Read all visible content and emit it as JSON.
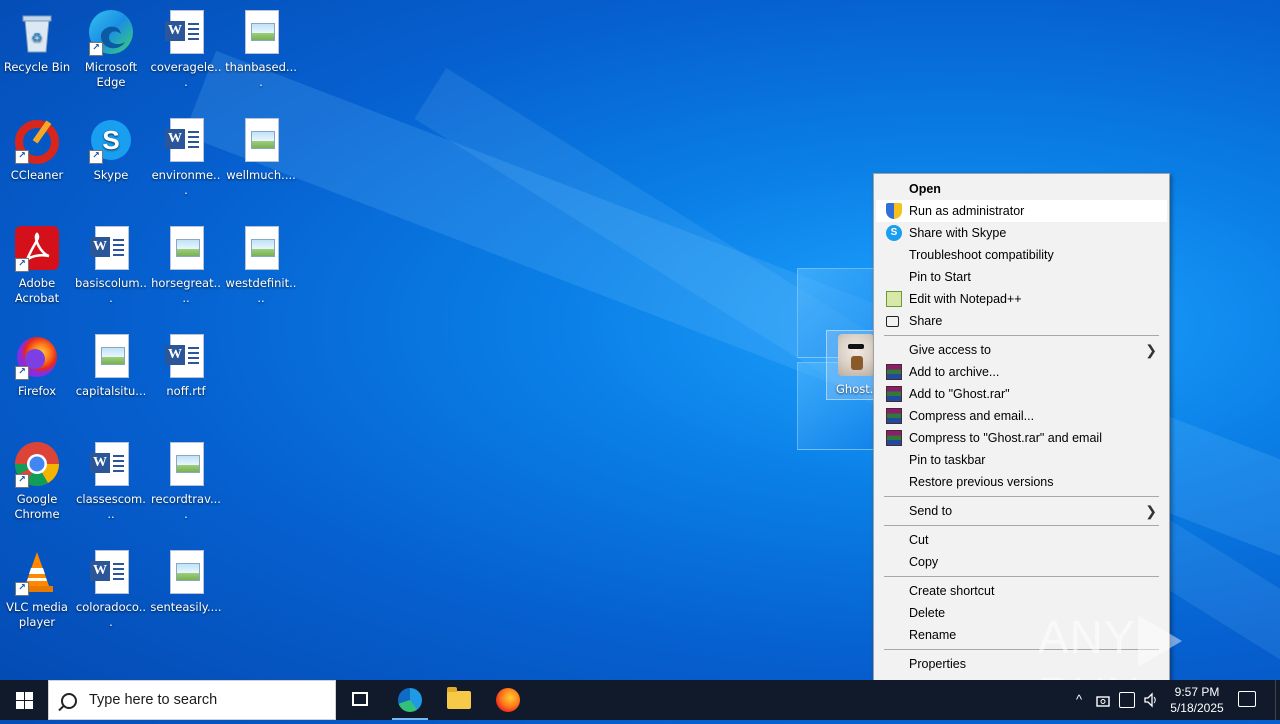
{
  "desktop": {
    "icons": [
      {
        "label": "Recycle Bin",
        "icon": "recycle-bin-icon"
      },
      {
        "label": "Microsoft Edge",
        "icon": "edge-icon"
      },
      {
        "label": "coveragele...",
        "icon": "word-doc-icon"
      },
      {
        "label": "thanbased....",
        "icon": "image-file-icon"
      },
      {
        "label": "CCleaner",
        "icon": "ccleaner-icon"
      },
      {
        "label": "Skype",
        "icon": "skype-icon"
      },
      {
        "label": "environme...",
        "icon": "word-doc-icon"
      },
      {
        "label": "wellmuch....",
        "icon": "image-file-icon"
      },
      {
        "label": "Adobe Acrobat",
        "icon": "acrobat-icon"
      },
      {
        "label": "basiscolum...",
        "icon": "word-doc-icon"
      },
      {
        "label": "horsegreat....",
        "icon": "image-file-icon"
      },
      {
        "label": "westdefinit....",
        "icon": "image-file-icon"
      },
      {
        "label": "Firefox",
        "icon": "firefox-icon"
      },
      {
        "label": "capitalsitu...",
        "icon": "image-file-icon"
      },
      {
        "label": "noff.rtf",
        "icon": "word-doc-icon"
      },
      {
        "label": "Google Chrome",
        "icon": "chrome-icon"
      },
      {
        "label": "classescom...",
        "icon": "word-doc-icon"
      },
      {
        "label": "recordtrav....",
        "icon": "image-file-icon"
      },
      {
        "label": "VLC media player",
        "icon": "vlc-icon"
      },
      {
        "label": "coloradoco...",
        "icon": "word-doc-icon"
      },
      {
        "label": "senteasily....",
        "icon": "image-file-icon"
      }
    ],
    "selected_file": {
      "label": "Ghost.e",
      "icon": "ghost-exe-icon"
    }
  },
  "context_menu": {
    "items": [
      {
        "label": "Open",
        "icon": ""
      },
      {
        "label": "Run as administrator",
        "icon": "uac-shield-icon"
      },
      {
        "label": "Share with Skype",
        "icon": "skype-icon"
      },
      {
        "label": "Troubleshoot compatibility",
        "icon": ""
      },
      {
        "label": "Pin to Start",
        "icon": ""
      },
      {
        "label": "Edit with Notepad++",
        "icon": "notepad-plus-plus-icon"
      },
      {
        "label": "Share",
        "icon": "share-icon"
      },
      {
        "label": "Give access to",
        "icon": ""
      },
      {
        "label": "Add to archive...",
        "icon": "winrar-icon"
      },
      {
        "label": "Add to \"Ghost.rar\"",
        "icon": "winrar-icon"
      },
      {
        "label": "Compress and email...",
        "icon": "winrar-icon"
      },
      {
        "label": "Compress to \"Ghost.rar\" and email",
        "icon": "winrar-icon"
      },
      {
        "label": "Pin to taskbar",
        "icon": ""
      },
      {
        "label": "Restore previous versions",
        "icon": ""
      },
      {
        "label": "Send to",
        "icon": ""
      },
      {
        "label": "Cut",
        "icon": ""
      },
      {
        "label": "Copy",
        "icon": ""
      },
      {
        "label": "Create shortcut",
        "icon": ""
      },
      {
        "label": "Delete",
        "icon": ""
      },
      {
        "label": "Rename",
        "icon": ""
      },
      {
        "label": "Properties",
        "icon": ""
      }
    ],
    "highlighted": "Run as administrator"
  },
  "watermark": {
    "left": "ANY",
    "right": "RUN"
  },
  "taskbar": {
    "search_placeholder": "Type here to search",
    "tray_chevron": "^",
    "time": "9:57 PM",
    "date": "5/18/2025"
  },
  "colors": {
    "taskbar": "#101a2a",
    "menu_bg": "#f2f2f2",
    "accent": "#76b9ed"
  }
}
